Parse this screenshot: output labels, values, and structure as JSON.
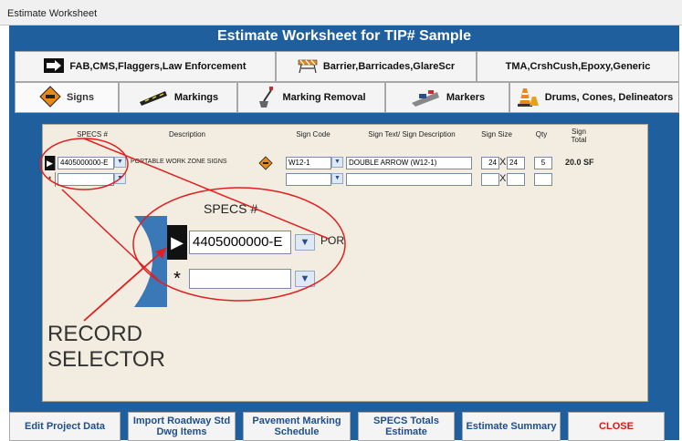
{
  "window": {
    "title": "Estimate Worksheet"
  },
  "header": {
    "title": "Estimate Worksheet for TIP# Sample"
  },
  "tabs_top": [
    {
      "label": "FAB,CMS,Flaggers,Law Enforcement",
      "icon": "arrow-sign-icon"
    },
    {
      "label": "Barrier,Barricades,GlareScr",
      "icon": "barricade-icon"
    },
    {
      "label": "TMA,CrshCush,Epoxy,Generic",
      "icon": ""
    }
  ],
  "tabs_bottom": [
    {
      "label": "Signs",
      "icon": "work-zone-sign-icon",
      "active": true
    },
    {
      "label": "Markings",
      "icon": "marking-tape-icon"
    },
    {
      "label": "Marking Removal",
      "icon": "marking-removal-icon"
    },
    {
      "label": "Markers",
      "icon": "road-marker-icon"
    },
    {
      "label": "Drums, Cones, Delineators",
      "icon": "traffic-cone-icon"
    }
  ],
  "grid": {
    "columns": {
      "specs": "SPECS #",
      "description": "Description",
      "sign_code": "Sign Code",
      "sign_text": "Sign Text/ Sign Description",
      "sign_size": "Sign Size",
      "qty": "Qty",
      "sign_total": "Sign Total"
    },
    "rows": [
      {
        "specs": "4405000000-E",
        "description": "PORTABLE WORK ZONE SIGNS",
        "sign_code": "W12-1",
        "sign_text": "DOUBLE ARROW (W12-1)",
        "size_w": "24",
        "size_h": "24",
        "qty": "5",
        "total": "20.0 SF"
      }
    ],
    "new_row_marker": "*",
    "size_separator": "X"
  },
  "zoom": {
    "header": "SPECS #",
    "specs": "4405000000-E",
    "desc_partial": "POR",
    "new_row_marker": "*"
  },
  "annotation": {
    "line1": "RECORD",
    "line2": "SELECTOR"
  },
  "buttons": [
    {
      "label": "Edit Project Data"
    },
    {
      "label": "Import Roadway Std Dwg Items"
    },
    {
      "label": "Pavement Marking Schedule"
    },
    {
      "label": "SPECS Totals Estimate"
    },
    {
      "label": "Estimate Summary"
    },
    {
      "label": "CLOSE"
    }
  ],
  "colors": {
    "frame": "#1f5f9e",
    "panel": "#f2ede0",
    "annotation": "#e02020",
    "close": "#d81818"
  }
}
